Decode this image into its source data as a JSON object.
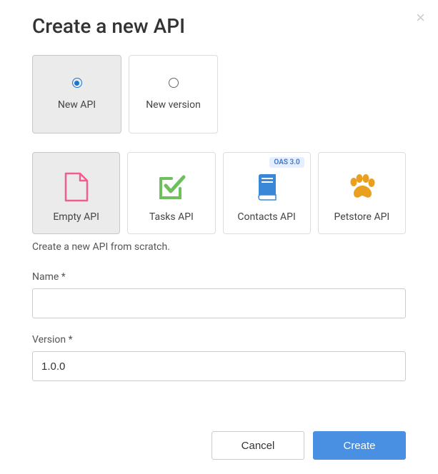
{
  "dialog": {
    "title": "Create a new API",
    "close_label": "×"
  },
  "modes": [
    {
      "label": "New API",
      "selected": true
    },
    {
      "label": "New version",
      "selected": false
    }
  ],
  "templates": [
    {
      "label": "Empty API",
      "selected": true,
      "badge": null,
      "icon": "file"
    },
    {
      "label": "Tasks API",
      "selected": false,
      "badge": null,
      "icon": "check"
    },
    {
      "label": "Contacts API",
      "selected": false,
      "badge": "OAS 3.0",
      "icon": "book"
    },
    {
      "label": "Petstore API",
      "selected": false,
      "badge": null,
      "icon": "paw"
    }
  ],
  "description": "Create a new API from scratch.",
  "fields": {
    "name": {
      "label": "Name *",
      "value": ""
    },
    "version": {
      "label": "Version *",
      "value": "1.0.0"
    }
  },
  "buttons": {
    "cancel": "Cancel",
    "create": "Create"
  }
}
